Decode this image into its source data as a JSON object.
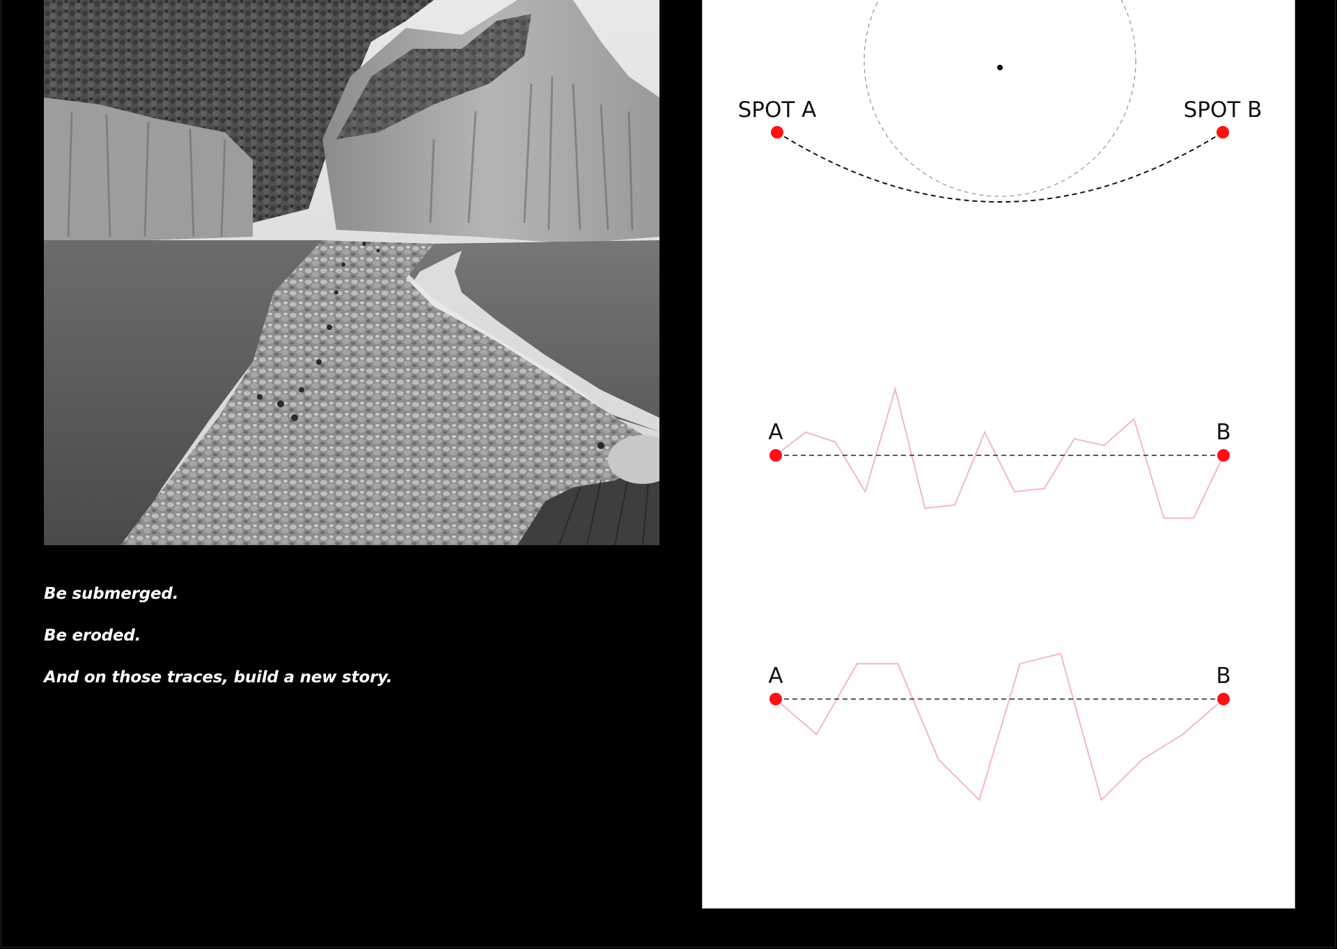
{
  "photo": {
    "description_icon": "coastal-rock-causeway-photo"
  },
  "caption": {
    "line1": "Be submerged.",
    "line2": "Be eroded.",
    "line3": "And on those traces, build a new story."
  },
  "diagram_top": {
    "spot_a_label": "SPOT A",
    "spot_b_label": "SPOT B"
  },
  "diagram_middle": {
    "a_label": "A",
    "b_label": "B",
    "trace": [
      0,
      0.35,
      0.2,
      -0.55,
      1.0,
      -0.8,
      -0.75,
      0.35,
      -0.55,
      -0.5,
      0.25,
      0.15,
      0.55,
      -0.95,
      -0.95,
      0
    ]
  },
  "diagram_bottom": {
    "a_label": "A",
    "b_label": "B",
    "trace": [
      0,
      -0.35,
      0.35,
      0.35,
      -0.6,
      -1.0,
      0.35,
      0.45,
      -1.0,
      -0.6,
      -0.35,
      0
    ]
  },
  "colors": {
    "background": "#000000",
    "panel": "#ffffff",
    "point": "#ff1111",
    "trace": "#f4b6c6",
    "dashed": "#222222"
  }
}
